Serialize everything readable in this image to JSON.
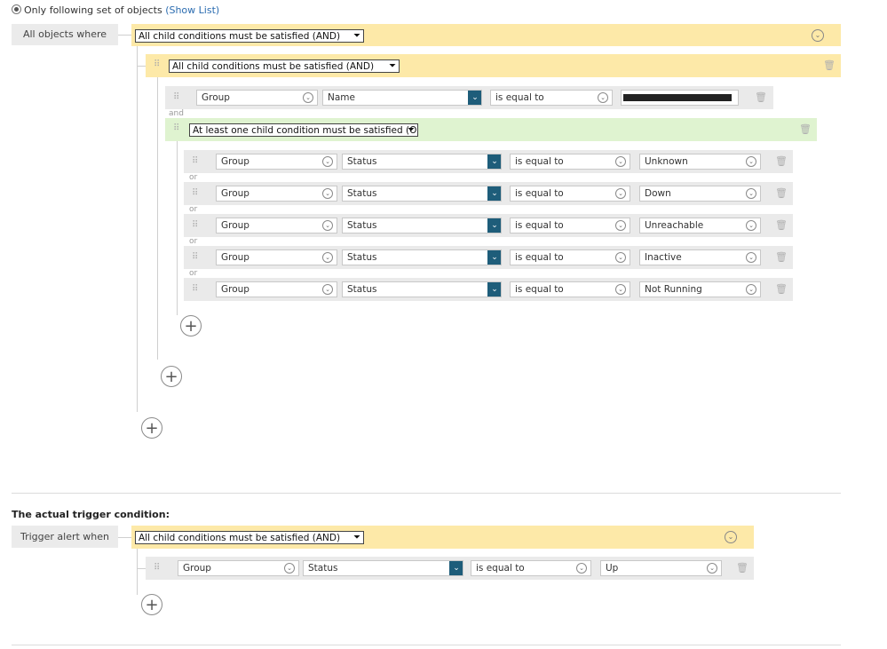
{
  "top": {
    "radio_label": "Only following set of objects",
    "show_list": "(Show List)"
  },
  "scope": {
    "label": "All objects where",
    "root_select": "All child conditions must be satisfied (AND)",
    "inner_and_select": "All child conditions must be satisfied (AND)",
    "name_row": {
      "object": "Group",
      "property": "Name",
      "operator": "is equal to",
      "value": ""
    },
    "and_connector": "and",
    "or_select": "At least one child condition must be satisfied (OR)",
    "or_connector": "or",
    "or_rows": [
      {
        "object": "Group",
        "property": "Status",
        "operator": "is equal to",
        "value": "Unknown"
      },
      {
        "object": "Group",
        "property": "Status",
        "operator": "is equal to",
        "value": "Down"
      },
      {
        "object": "Group",
        "property": "Status",
        "operator": "is equal to",
        "value": "Unreachable"
      },
      {
        "object": "Group",
        "property": "Status",
        "operator": "is equal to",
        "value": "Inactive"
      },
      {
        "object": "Group",
        "property": "Status",
        "operator": "is equal to",
        "value": "Not Running"
      }
    ]
  },
  "trigger": {
    "title": "The actual trigger condition:",
    "label": "Trigger alert when",
    "root_select": "All child conditions must be satisfied (AND)",
    "row": {
      "object": "Group",
      "property": "Status",
      "operator": "is equal to",
      "value": "Up"
    }
  },
  "icons": {
    "grip": "drag-handle-icon",
    "trash": "trash-icon",
    "add": "plus-icon",
    "expand": "chevron-down-circle-icon"
  },
  "colors": {
    "and_block": "#fde9a8",
    "or_block": "#dff3d0",
    "row": "#eaeaea",
    "accent": "#1e5d7a",
    "link": "#2b6cb0"
  }
}
